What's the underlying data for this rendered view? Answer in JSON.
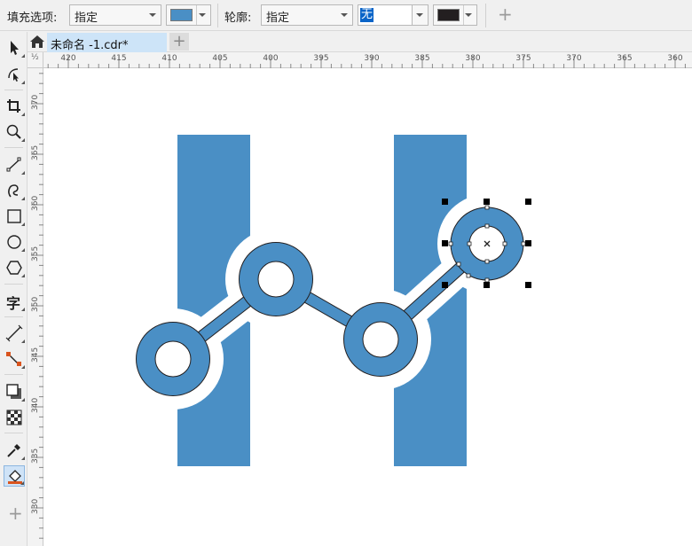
{
  "property_bar": {
    "fill_label": "填充选项:",
    "fill_mode": "指定",
    "fill_color": "#4a8fc5",
    "outline_label": "轮廓:",
    "outline_mode": "指定",
    "outline_width": "无",
    "outline_color": "#231f20",
    "add_symbol": "+"
  },
  "tabs": {
    "document_tab": "未命名 -1.cdr*",
    "add_tab_symbol": "+"
  },
  "toolbox": {
    "tools": [
      "pick-tool",
      "shape-tool",
      "crop-tool",
      "zoom-tool",
      "freehand-tool",
      "artistic-media-tool",
      "rectangle-tool",
      "ellipse-tool",
      "polygon-tool",
      "text-tool",
      "parallel-dimension-tool",
      "connector-tool",
      "drop-shadow-tool",
      "transparency-tool",
      "color-eyedropper-tool",
      "interactive-fill-tool"
    ],
    "active_tool": "interactive-fill-tool",
    "text_tool_glyph": "字",
    "add_tool_symbol": "+"
  },
  "rulers": {
    "horizontal": [
      "420",
      "415",
      "410",
      "405",
      "400",
      "395",
      "390",
      "385",
      "380",
      "375",
      "370",
      "365",
      "360"
    ],
    "vertical": [
      "370",
      "365",
      "360",
      "355",
      "350",
      "345",
      "340",
      "335",
      "330"
    ],
    "corner": "½"
  },
  "canvas": {
    "shape_color": "#4a8fc5",
    "outline_color": "#231f20",
    "selected_object": "ring-node-4"
  }
}
